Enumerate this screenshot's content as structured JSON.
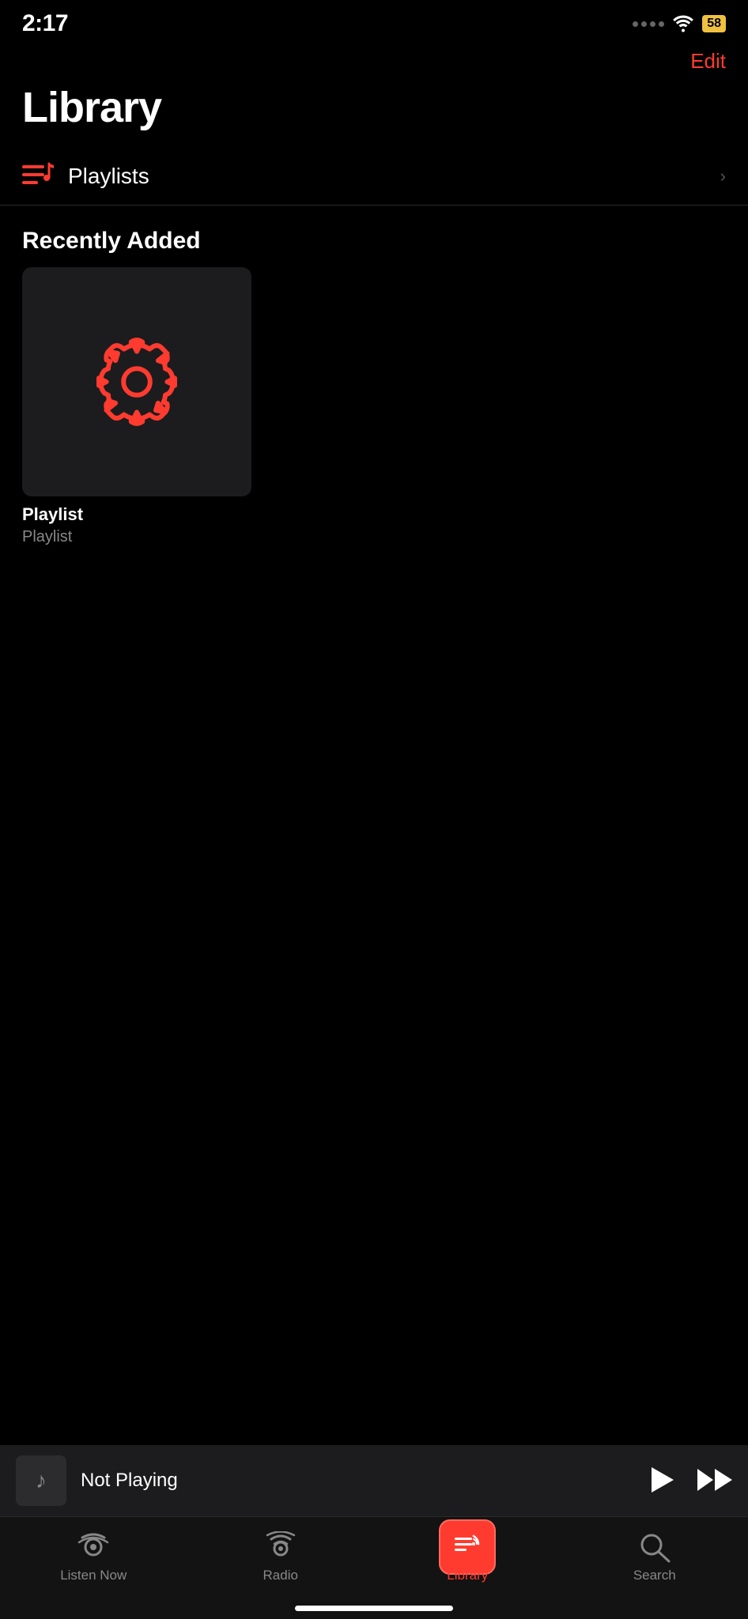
{
  "statusBar": {
    "time": "2:17",
    "battery": "58"
  },
  "header": {
    "editLabel": "Edit"
  },
  "page": {
    "title": "Library"
  },
  "playlists": {
    "label": "Playlists"
  },
  "recentlyAdded": {
    "sectionTitle": "Recently Added",
    "items": [
      {
        "title": "Playlist",
        "subtitle": "Playlist"
      }
    ]
  },
  "nowPlaying": {
    "label": "Not Playing"
  },
  "tabBar": {
    "tabs": [
      {
        "label": "Listen Now",
        "active": false
      },
      {
        "label": "Radio",
        "active": false
      },
      {
        "label": "Library",
        "active": true
      },
      {
        "label": "Search",
        "active": false
      }
    ]
  }
}
